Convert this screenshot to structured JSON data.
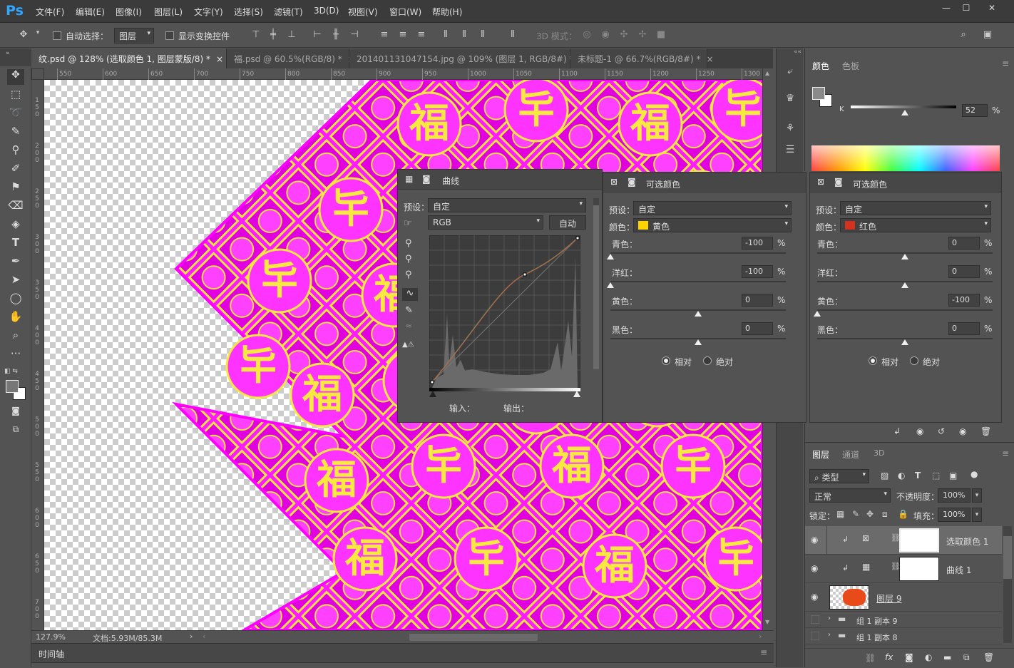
{
  "menubar": {
    "logo": "Ps",
    "items": [
      "文件(F)",
      "编辑(E)",
      "图像(I)",
      "图层(L)",
      "文字(Y)",
      "选择(S)",
      "滤镜(T)",
      "3D(D)",
      "视图(V)",
      "窗口(W)",
      "帮助(H)"
    ]
  },
  "options": {
    "auto_select_label": "自动选择：",
    "layer_select": "图层",
    "show_transform_label": "显示变换控件",
    "mode_3d_label": "3D 模式："
  },
  "tabs": [
    {
      "label": "纹.psd @ 128% (选取颜色 1, 图层蒙版/8) *",
      "active": true
    },
    {
      "label": "福.psd @ 60.5%(RGB/8) *",
      "active": false
    },
    {
      "label": "201401131047154.jpg @ 109% (图层 1, RGB/8#) *",
      "active": false
    },
    {
      "label": "未标题-1 @ 66.7%(RGB/8#) *",
      "active": false
    }
  ],
  "ruler_top": [
    "550",
    "600",
    "650",
    "700",
    "750",
    "800",
    "850",
    "900",
    "950",
    "1000",
    "1050",
    "1100",
    "1150",
    "1200",
    "1250",
    "1300"
  ],
  "ruler_left": [
    "1\n5\n0",
    "2\n0\n0",
    "2\n5\n0",
    "3\n0\n0",
    "3\n5\n0",
    "4\n0\n0",
    "4\n5\n0",
    "5\n0\n0",
    "5\n5\n0",
    "6\n0\n0",
    "6\n5\n0",
    "7\n0\n0"
  ],
  "canvas": {
    "glyph_fu": "福",
    "glyph_fu_alt": "𠤏"
  },
  "status": {
    "zoom": "127.9%",
    "doc": "文档:5.93M/85.3M"
  },
  "timeline": {
    "label": "时间轴"
  },
  "color_panel": {
    "tab1": "颜色",
    "tab2": "色板",
    "channel": "K",
    "value": "52",
    "unit": "%"
  },
  "curves": {
    "title": "曲线",
    "preset_label": "预设：",
    "preset_value": "自定",
    "channel": "RGB",
    "auto_label": "自动",
    "input_label": "输入：",
    "output_label": "输出："
  },
  "selcolor1": {
    "title": "可选颜色",
    "preset_label": "预设：",
    "preset_value": "自定",
    "color_label": "颜色：",
    "color_value": "黄色",
    "swatch": "#ffd400",
    "rows": [
      {
        "label": "青色：",
        "value": "-100"
      },
      {
        "label": "洋红：",
        "value": "-100"
      },
      {
        "label": "黄色：",
        "value": "0"
      },
      {
        "label": "黑色：",
        "value": "0"
      }
    ],
    "rel": "相对",
    "abs": "绝对"
  },
  "selcolor2": {
    "title": "可选颜色",
    "preset_label": "预设：",
    "preset_value": "自定",
    "color_label": "颜色：",
    "color_value": "红色",
    "swatch": "#d2321e",
    "rows": [
      {
        "label": "青色：",
        "value": "0"
      },
      {
        "label": "洋红：",
        "value": "0"
      },
      {
        "label": "黄色：",
        "value": "-100"
      },
      {
        "label": "黑色：",
        "value": "0"
      }
    ],
    "rel": "相对",
    "abs": "绝对"
  },
  "layers": {
    "tab1": "图层",
    "tab2": "通道",
    "tab3": "3D",
    "filter": "类型",
    "blend": "正常",
    "opacity_label": "不透明度：",
    "opacity": "100%",
    "lock_label": "锁定：",
    "fill_label": "填充：",
    "fill": "100%",
    "items": [
      {
        "name": "选取颜色 1"
      },
      {
        "name": "曲线 1"
      },
      {
        "name": "图层 9"
      },
      {
        "name": "组 1 副本 9"
      },
      {
        "name": "组 1 副本 8"
      }
    ]
  },
  "colors": {
    "accent": "#31a8ff",
    "magenta": "#ff00ff",
    "yellow": "#f8e840"
  }
}
